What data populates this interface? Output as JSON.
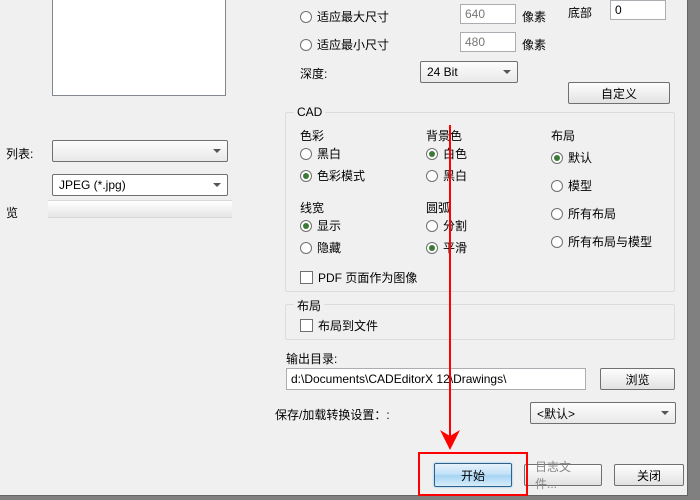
{
  "left": {
    "list_label": "列表:",
    "preview_label": "览",
    "format_selected": "",
    "file_format": "JPEG (*.jpg)"
  },
  "size_opts": {
    "max_label": "适应最大尺寸",
    "max_val": "640",
    "min_label": "适应最小尺寸",
    "min_val": "480",
    "px": "像素",
    "depth_label": "深度:",
    "depth_val": "24 Bit",
    "bottom_label": "底部",
    "bottom_val": "0",
    "custom_btn": "自定义"
  },
  "cad": {
    "legend": "CAD",
    "color_label": "色彩",
    "color_opts": {
      "bw": "黑白",
      "mode": "色彩模式"
    },
    "bg_label": "背景色",
    "bg_opts": {
      "white": "白色",
      "black": "黑白"
    },
    "layout_label": "布局",
    "layout_opts": {
      "def": "默认",
      "model": "模型",
      "all": "所有布局",
      "allmodel": "所有布局与模型"
    },
    "lw_label": "线宽",
    "lw_opts": {
      "show": "显示",
      "hide": "隐藏"
    },
    "arc_label": "圆弧",
    "arc_opts": {
      "split": "分割",
      "smooth": "平滑"
    },
    "pdf_chk": "PDF 页面作为图像"
  },
  "layout2": {
    "legend": "布局",
    "chk": "布局到文件"
  },
  "outdir": {
    "label": "输出目录:",
    "value": "d:\\Documents\\CADEditorX 12\\Drawings\\",
    "browse": "浏览"
  },
  "save_settings": {
    "label": "保存/加载转换设置：:",
    "value": "<默认>"
  },
  "buttons": {
    "start": "开始",
    "log": "日志文件...",
    "close": "关闭"
  }
}
